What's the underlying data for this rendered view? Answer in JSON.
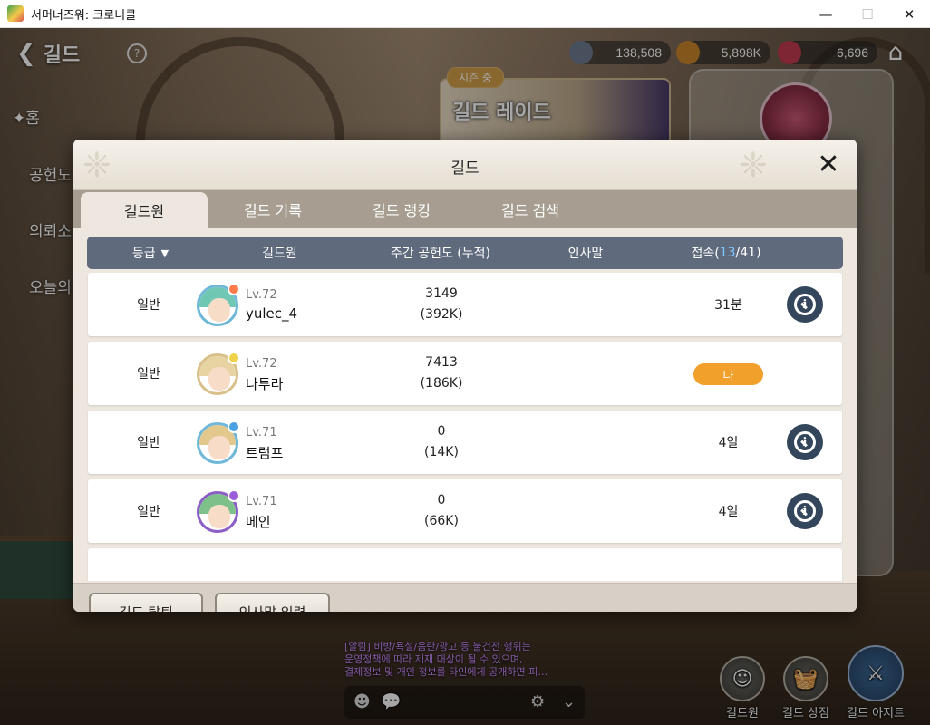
{
  "window": {
    "title": "서머너즈워: 크로니클",
    "minimize": "—",
    "maximize": "☐",
    "close": "✕"
  },
  "top": {
    "back_label": "길드",
    "currencies": [
      {
        "value": "138,508",
        "icon": "crystal-coin-icon",
        "color": "#6f7c8f"
      },
      {
        "value": "5,898K",
        "icon": "gold-coin-icon",
        "color": "#c9862c"
      },
      {
        "value": "6,696",
        "icon": "ruby-icon",
        "color": "#c23b4f"
      }
    ]
  },
  "raid": {
    "season_badge": "시즌 중",
    "title": "길드 레이드"
  },
  "side_menu": [
    "홈",
    "공헌도",
    "의뢰소",
    "오늘의"
  ],
  "modal": {
    "title": "길드",
    "tabs": [
      "길드원",
      "길드 기록",
      "길드 랭킹",
      "길드 검색"
    ],
    "active_tab": 0,
    "headers": {
      "grade": "등급",
      "member": "길드원",
      "weekly": "주간 공헌도 (누적)",
      "greeting": "인사말",
      "access_prefix": "접속(",
      "online": "13",
      "access_suffix": "/41)"
    },
    "rows": [
      {
        "grade": "일반",
        "level": "Lv.72",
        "name": "yulec_4",
        "weekly": "3149",
        "total": "(392K)",
        "greeting": "",
        "access": "31분",
        "is_me": false
      },
      {
        "grade": "일반",
        "level": "Lv.72",
        "name": "나투라",
        "weekly": "7413",
        "total": "(186K)",
        "greeting": "",
        "access": "",
        "is_me": true,
        "me_label": "나"
      },
      {
        "grade": "일반",
        "level": "Lv.71",
        "name": "트럼프",
        "weekly": "0",
        "total": "(14K)",
        "greeting": "",
        "access": "4일",
        "is_me": false
      },
      {
        "grade": "일반",
        "level": "Lv.71",
        "name": "메인",
        "weekly": "0",
        "total": "(66K)",
        "greeting": "",
        "access": "4일",
        "is_me": false
      }
    ],
    "footer": {
      "leave_label": "길드 탈퇴",
      "greeting_label": "인사말 입력"
    }
  },
  "notice": {
    "line1": "[알림] 비방/욕설/음란/광고 등 불건전 행위는",
    "line2": "운영정책에 따라 제재 대상이 될 수 있으며,",
    "line3": "결제정보 및 개인 정보를 타인에게 공개하면 피…"
  },
  "bottom_nav": [
    {
      "label": "길드원",
      "icon": "members-icon"
    },
    {
      "label": "길드 상점",
      "icon": "basket-icon"
    },
    {
      "label": "길드 아지트",
      "icon": "crossed-swords-icon"
    }
  ],
  "colors": {
    "header_bar": "#5f6a7d",
    "online_highlight": "#7ec6ff",
    "me_badge": "#f0a02b",
    "view_button": "#34465c"
  }
}
